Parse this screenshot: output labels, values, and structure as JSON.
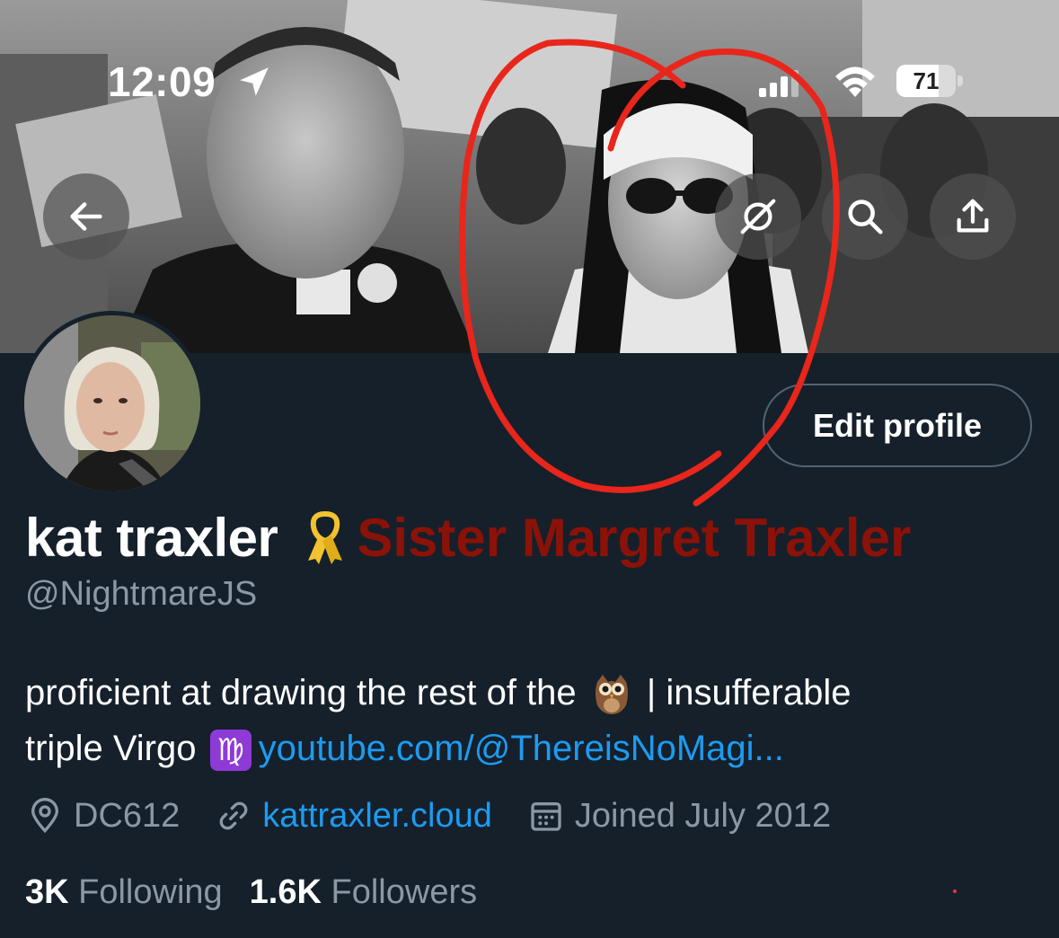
{
  "status_bar": {
    "time": "12:09",
    "battery_level": "71",
    "battery_fraction": 0.71
  },
  "header": {
    "icons": [
      "back-arrow-icon",
      "grok-icon",
      "search-icon",
      "share-icon"
    ]
  },
  "profile": {
    "edit_label": "Edit profile",
    "display_name": "kat traxler",
    "ribbon_emoji": "🎗",
    "annotation_text": "Sister Margret Traxler",
    "handle": "@NightmareJS",
    "bio_line1_text": "proficient at drawing the rest of the ",
    "owl_emoji": "🦉",
    "bio_line1_suffix": " | insufferable",
    "bio_line2_text": "triple Virgo ",
    "virgo_symbol": "♍",
    "bio_link": "youtube.com/@ThereisNoMagi...",
    "location": "DC612",
    "website": "kattraxler.cloud",
    "joined": "Joined July 2012",
    "following_count": "3K",
    "following_label": "Following",
    "followers_count": "1.6K",
    "followers_label": "Followers"
  },
  "colors": {
    "background": "#15202b",
    "link": "#1d9bf0",
    "muted": "#8b98a5",
    "annotation": "#8b1208",
    "annotation_circle": "#e8261c"
  }
}
